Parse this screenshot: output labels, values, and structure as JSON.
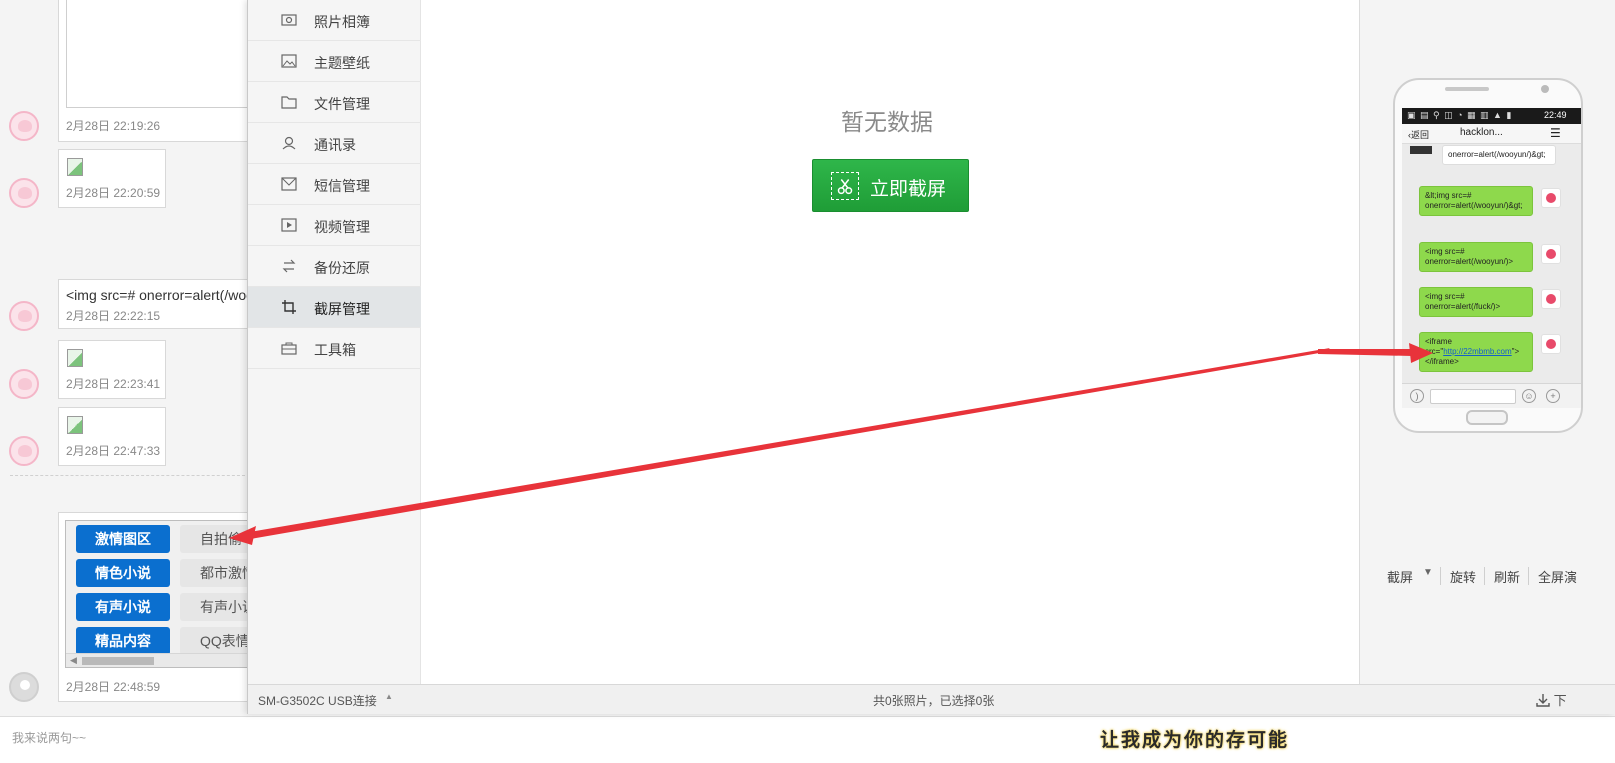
{
  "chat": {
    "messages": [
      {
        "type": "image",
        "time": "2月28日 22:19:26"
      },
      {
        "type": "image",
        "time": "2月28日 22:20:59"
      },
      {
        "type": "text",
        "text": "<img src=# onerror=alert(/woo",
        "time": "2月28日 22:22:15"
      },
      {
        "type": "image",
        "time": "2月28日 22:23:41"
      },
      {
        "type": "image",
        "time": "2月28日 22:47:33"
      },
      {
        "type": "menu",
        "time": "2月28日 22:48:59"
      }
    ],
    "menu_rows": [
      {
        "primary": "激情图区",
        "secondary": "自拍偷"
      },
      {
        "primary": "情色小说",
        "secondary": "都市激情"
      },
      {
        "primary": "有声小说",
        "secondary": "有声小说"
      },
      {
        "primary": "精品内容",
        "secondary": "QQ表情"
      }
    ],
    "comment_placeholder": "我来说两句~~",
    "banner_text": "让我成为你的存可能"
  },
  "manager": {
    "nav": [
      {
        "icon": "photo-album-icon",
        "label": "照片相簿"
      },
      {
        "icon": "wallpaper-icon",
        "label": "主题壁纸"
      },
      {
        "icon": "folder-icon",
        "label": "文件管理"
      },
      {
        "icon": "contacts-icon",
        "label": "通讯录"
      },
      {
        "icon": "sms-icon",
        "label": "短信管理"
      },
      {
        "icon": "video-icon",
        "label": "视频管理"
      },
      {
        "icon": "backup-icon",
        "label": "备份还原"
      },
      {
        "icon": "screenshot-icon",
        "label": "截屏管理",
        "active": true
      },
      {
        "icon": "toolbox-icon",
        "label": "工具箱"
      }
    ],
    "empty_text": "暂无数据",
    "capture_button": "立即截屏",
    "controls": {
      "screenshot": "截屏",
      "rotate": "旋转",
      "refresh": "刷新",
      "fullscreen": "全屏演"
    },
    "status": {
      "device": "SM-G3502C  USB连接",
      "summary": "共0张照片，已选择0张",
      "download": "下"
    }
  },
  "phone": {
    "clock": "22:49",
    "back": "返回",
    "contact": "hacklon...",
    "messages_in": [
      "onerror=alert(/wooyun/)&gt;"
    ],
    "messages_out": [
      "&lt;img src=# onerror=alert(/wooyun/)&gt;",
      "<img src=# onerror=alert(/wooyun/)>",
      "<img src=# onerror=alert(/fuck/)>"
    ],
    "iframe_msg": {
      "prefix": "<iframe src=\"",
      "link": "http://22mbmb.com",
      "suffix": "\"></iframe>"
    }
  },
  "colors": {
    "accent_green": "#1f9d37",
    "menu_blue": "#0b6fcf",
    "arrow_red": "#e8333a",
    "bubble_green": "#8ed94c"
  }
}
